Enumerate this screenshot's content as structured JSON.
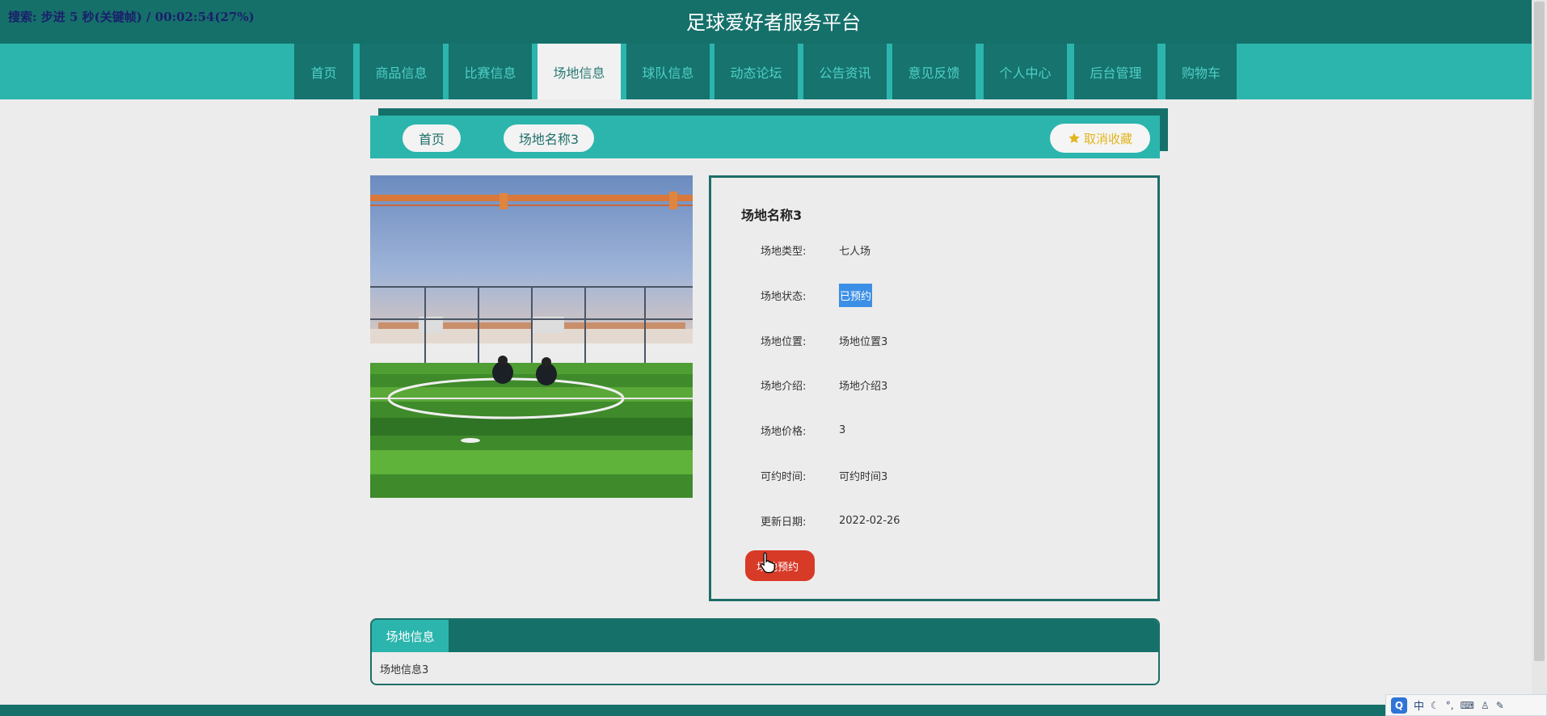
{
  "player_status": "搜索: 步进 5 秒(关键帧) / 00:02:54(27%)",
  "site_title": "足球爱好者服务平台",
  "nav": {
    "items": [
      "首页",
      "商品信息",
      "比赛信息",
      "场地信息",
      "球队信息",
      "动态论坛",
      "公告资讯",
      "意见反馈",
      "个人中心",
      "后台管理",
      "购物车"
    ],
    "active": "场地信息"
  },
  "breadcrumb": {
    "home": "首页",
    "current": "场地名称3",
    "favorite_label": "取消收藏"
  },
  "detail": {
    "title": "场地名称3",
    "fields": [
      {
        "label": "场地类型:",
        "value": "七人场"
      },
      {
        "label": "场地状态:",
        "value": "已预约"
      },
      {
        "label": "场地位置:",
        "value": "场地位置3"
      },
      {
        "label": "场地介绍:",
        "value": "场地介绍3"
      },
      {
        "label": "场地价格:",
        "value": "3"
      },
      {
        "label": "可约时间:",
        "value": "可约时间3"
      },
      {
        "label": "更新日期:",
        "value": "2022-02-26"
      }
    ],
    "book_button": "场地预约"
  },
  "info": {
    "tab": "场地信息",
    "content": "场地信息3"
  },
  "ime": {
    "logo": "Q",
    "mode": "中"
  },
  "colors": {
    "primary_dark": "#15706a",
    "primary": "#2bb5ad",
    "danger": "#d83a28",
    "star": "#e2b51c"
  }
}
